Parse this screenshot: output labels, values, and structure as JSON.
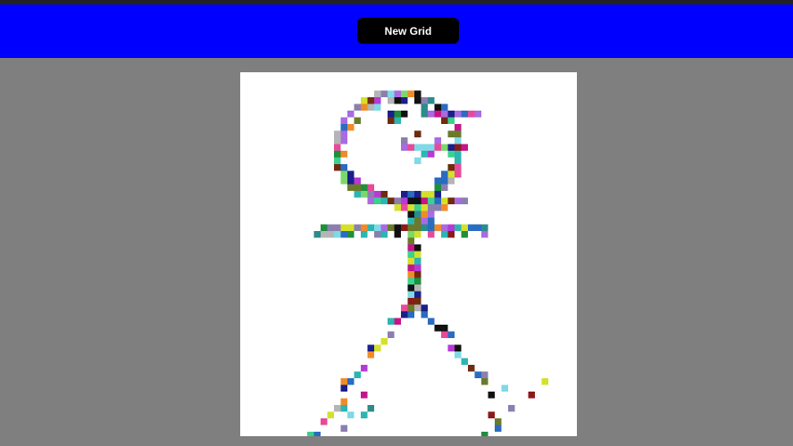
{
  "header": {
    "button_label": "New Grid"
  },
  "canvas": {
    "background": "#ffffff"
  },
  "pixel_palette": [
    "#111111",
    "#1b1f8a",
    "#2a6cc0",
    "#2bb6b1",
    "#3bd18e",
    "#1e8f3b",
    "#6f2b0f",
    "#8b1a1a",
    "#c4168a",
    "#b63ad6",
    "#a86be0",
    "#e84a9a",
    "#f08b2a",
    "#d4e12a",
    "#7bd86b",
    "#6b7a2a",
    "#2c8b8b",
    "#b5b5b5",
    "#7fd9e6",
    "#8b7fb0"
  ]
}
